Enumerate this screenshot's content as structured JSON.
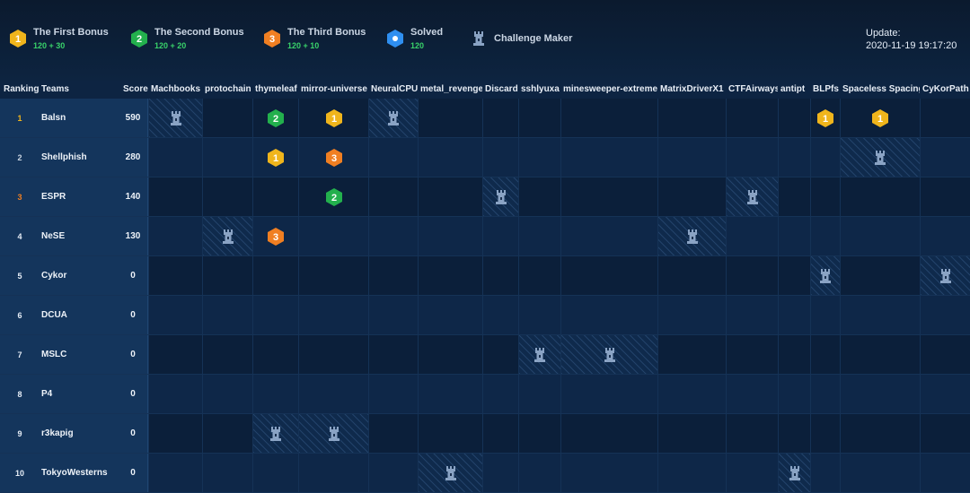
{
  "legend": [
    {
      "title": "The First Bonus",
      "sub": "120 + 30",
      "icon": "first-bonus-icon",
      "color": "#f0b51c",
      "glyph": "1"
    },
    {
      "title": "The Second Bonus",
      "sub": "120 + 20",
      "icon": "second-bonus-icon",
      "color": "#23b04d",
      "glyph": "2"
    },
    {
      "title": "The Third Bonus",
      "sub": "120 + 10",
      "icon": "third-bonus-icon",
      "color": "#f07f22",
      "glyph": "3"
    },
    {
      "title": "Solved",
      "sub": "120",
      "icon": "solved-icon",
      "color": "#2f8ff0",
      "glyph": "•"
    },
    {
      "title": "Challenge Maker",
      "sub": "",
      "icon": "challenge-maker-icon",
      "color": "#8aa3c4",
      "glyph": ""
    }
  ],
  "update": {
    "label": "Update:",
    "time": "2020-11-19 19:17:20"
  },
  "columns": {
    "ranking": "Ranking",
    "teams": "Teams",
    "score": "Score"
  },
  "challenges": [
    "Machbooks",
    "protochain",
    "thymeleaf",
    "mirror-universe",
    "NeuralCPU",
    "metal_revenge",
    "Discard",
    "sshlyuxa",
    "minesweeper-extreme",
    "MatrixDriverX1",
    "CTFAirways",
    "antipt",
    "BLPfs",
    "Spaceless Spacing",
    "CyKorPath"
  ],
  "status_colors": {
    "first": "#f0b51c",
    "second": "#23b04d",
    "third": "#f07f22",
    "solved": "#2f8ff0",
    "maker": "#8aa3c4"
  },
  "rank_colors": {
    "1": "#f0b51c",
    "2": "#c8d3e0",
    "3": "#f07f22",
    "default": "#e6edf6"
  },
  "rows": [
    {
      "rank": "1",
      "team": "Balsn",
      "score": "590",
      "cells": {
        "0": "maker",
        "2": "second",
        "3": "first",
        "4": "maker",
        "12": "first",
        "13": "first"
      }
    },
    {
      "rank": "2",
      "team": "Shellphish",
      "score": "280",
      "cells": {
        "2": "first",
        "3": "third",
        "13": "maker"
      }
    },
    {
      "rank": "3",
      "team": "ESPR",
      "score": "140",
      "cells": {
        "3": "second",
        "6": "maker",
        "10": "maker"
      }
    },
    {
      "rank": "4",
      "team": "NeSE",
      "score": "130",
      "cells": {
        "1": "maker",
        "2": "third",
        "9": "maker"
      }
    },
    {
      "rank": "5",
      "team": "Cykor",
      "score": "0",
      "cells": {
        "12": "maker",
        "14": "maker"
      }
    },
    {
      "rank": "6",
      "team": "DCUA",
      "score": "0",
      "cells": {}
    },
    {
      "rank": "7",
      "team": "MSLC",
      "score": "0",
      "cells": {
        "7": "maker",
        "8": "maker"
      }
    },
    {
      "rank": "8",
      "team": "P4",
      "score": "0",
      "cells": {}
    },
    {
      "rank": "9",
      "team": "r3kapig",
      "score": "0",
      "cells": {
        "2": "maker",
        "3": "maker"
      }
    },
    {
      "rank": "10",
      "team": "TokyoWesterns",
      "score": "0",
      "cells": {
        "5": "maker",
        "11": "maker"
      }
    }
  ]
}
